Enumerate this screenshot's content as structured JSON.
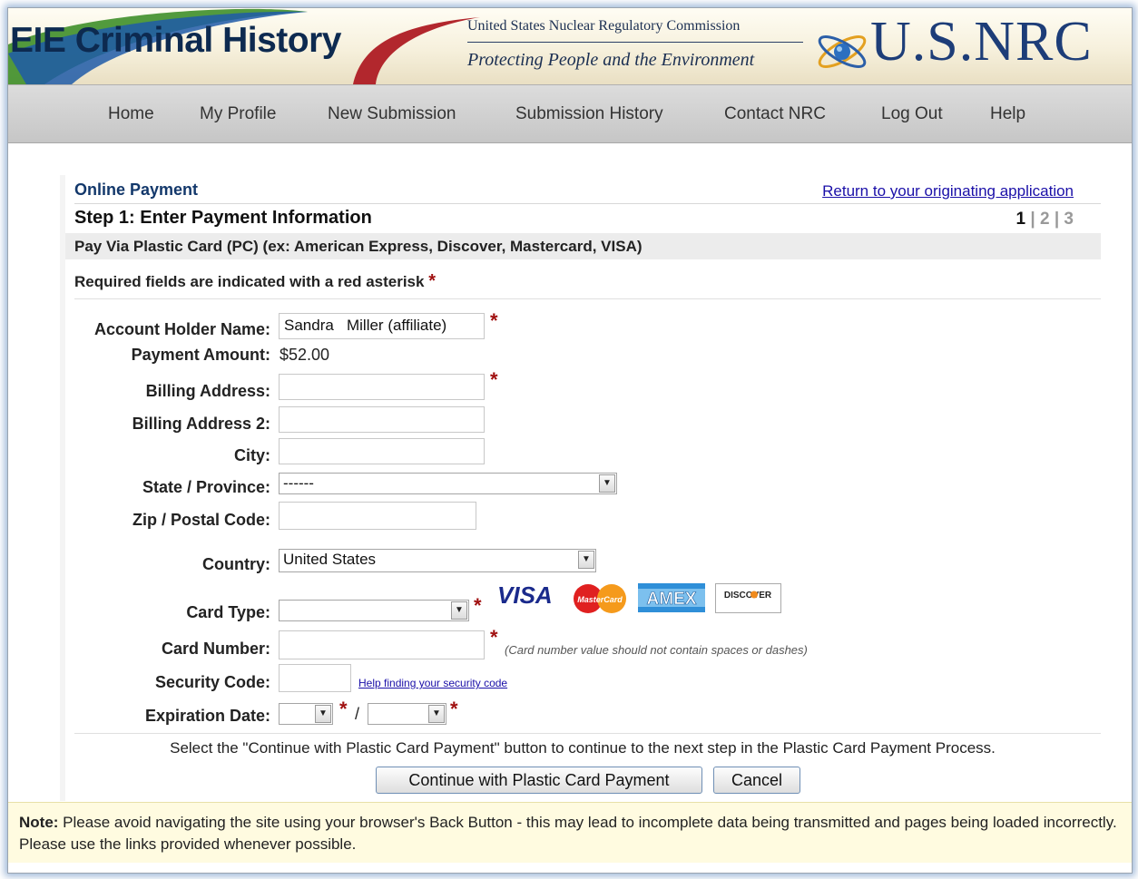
{
  "header": {
    "app_title": "EIE Criminal History",
    "org_line": "United States Nuclear Regulatory Commission",
    "tagline": "Protecting People and the Environment",
    "logo_text": "U.S.NRC"
  },
  "nav": {
    "items": [
      "Home",
      "My Profile",
      "New Submission",
      "Submission History",
      "Contact NRC",
      "Log Out",
      "Help"
    ]
  },
  "page": {
    "section_title": "Online Payment",
    "return_link": "Return to your originating application",
    "step_title": "Step 1: Enter Payment Information",
    "steps": {
      "current": "1",
      "sep": " | ",
      "s2": "2",
      "s3": "3"
    },
    "pay_via": "Pay Via Plastic Card (PC) (ex: American Express, Discover, Mastercard, VISA)",
    "required_note": "Required fields are indicated with a red asterisk",
    "asterisk": "*"
  },
  "form": {
    "account_holder_label": "Account Holder Name:",
    "account_holder_value": "Sandra   Miller (affiliate)",
    "payment_amount_label": "Payment Amount:",
    "payment_amount_value": "$52.00",
    "billing_address_label": "Billing Address:",
    "billing_address_value": "",
    "billing_address2_label": "Billing Address 2:",
    "billing_address2_value": "",
    "city_label": "City:",
    "city_value": "",
    "state_label": "State / Province:",
    "state_value": "------",
    "zip_label": "Zip / Postal Code:",
    "zip_value": "",
    "country_label": "Country:",
    "country_value": "United States",
    "card_type_label": "Card Type:",
    "card_type_value": "",
    "card_logos": [
      "VISA",
      "MasterCard",
      "AMEX",
      "DISCOVER"
    ],
    "card_number_label": "Card Number:",
    "card_number_value": "",
    "card_number_hint": "(Card number value should not contain spaces or dashes)",
    "security_code_label": "Security Code:",
    "security_code_value": "",
    "security_help_link": "Help finding your security code",
    "expiration_label": "Expiration Date:",
    "expiration_month": "",
    "expiration_year": "",
    "expiration_sep": "/"
  },
  "actions": {
    "instruction": "Select the \"Continue with Plastic Card Payment\" button to continue to the next step in the Plastic Card Payment Process.",
    "continue_label": "Continue with Plastic Card Payment",
    "cancel_label": "Cancel"
  },
  "note": {
    "label": "Note:",
    "text": " Please avoid navigating the site using your browser's Back Button - this may lead to incomplete data being transmitted and pages being loaded incorrectly. Please use the links provided whenever possible."
  },
  "colors": {
    "nav_bg": "#cfcfcf",
    "title_blue": "#13386b",
    "link_blue": "#1a0fa8",
    "required_red": "#a01010",
    "note_bg": "#fffbe0"
  },
  "icons": [
    "dropdown-arrow-icon",
    "nrc-atom-logo-icon",
    "visa-logo",
    "mastercard-logo",
    "amex-logo",
    "discover-logo"
  ]
}
